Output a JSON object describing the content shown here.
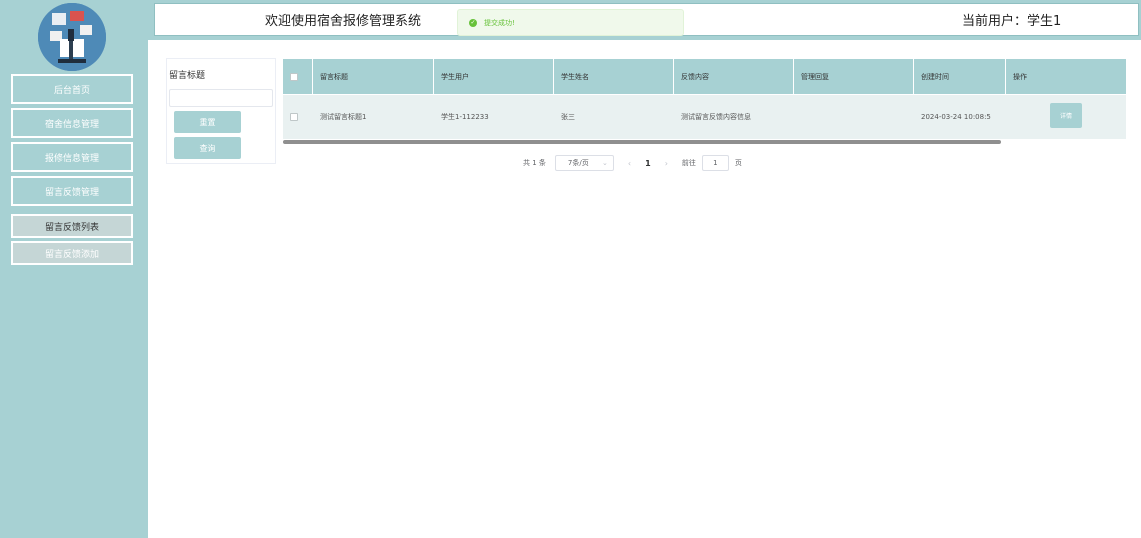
{
  "header": {
    "title": "欢迎使用宿舍报修管理系统",
    "current_user": "当前用户：学生1"
  },
  "toast": {
    "message": "提交成功!"
  },
  "sidebar": {
    "items": [
      {
        "label": "后台首页"
      },
      {
        "label": "宿舍信息管理"
      },
      {
        "label": "报修信息管理"
      },
      {
        "label": "留言反馈管理"
      }
    ],
    "sub_items": [
      {
        "label": "留言反馈列表"
      },
      {
        "label": "留言反馈添加"
      }
    ]
  },
  "filter": {
    "label": "留言标题",
    "input_value": "",
    "reset_label": "重置",
    "query_label": "查询"
  },
  "table": {
    "columns": [
      "留言标题",
      "学生用户",
      "学生姓名",
      "反馈内容",
      "管理回复",
      "创建时间",
      "操作"
    ],
    "rows": [
      {
        "title": "测试留言标题1",
        "user": "学生1-112233",
        "name": "张三",
        "content": "测试留言反馈内容信息",
        "reply": "",
        "created": "2024-03-24 10:08:5",
        "action": "详情"
      }
    ]
  },
  "pagination": {
    "total": "共 1 条",
    "page_size": "7条/页",
    "prev": "‹",
    "current": "1",
    "next": "›",
    "goto_label": "前往",
    "goto_value": "1",
    "page_suffix": "页"
  },
  "colors": {
    "accent": "#a7d1d3",
    "success": "#67c23a"
  }
}
